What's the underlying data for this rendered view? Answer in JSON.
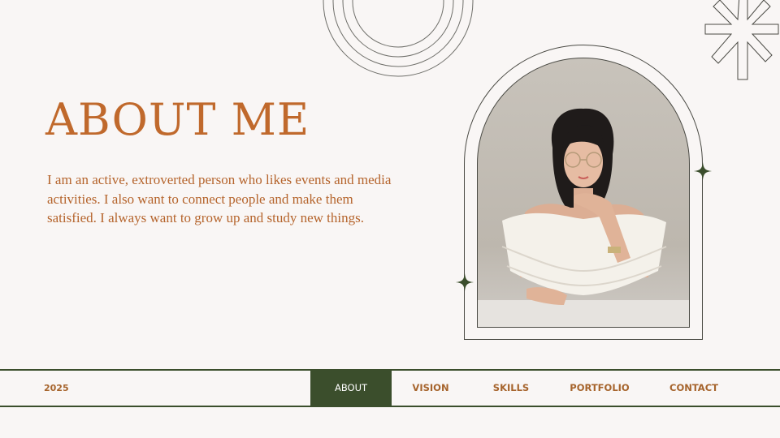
{
  "colors": {
    "background": "#f9f6f5",
    "accent": "#c0692c",
    "dark_green": "#3b4e2c",
    "line": "#4a4a44"
  },
  "title": "ABOUT ME",
  "bio": "I am an active, extroverted person who likes events and media activities. I also want to connect people and make them satisfied. I always want to grow up and study new things.",
  "photo": {
    "alt": "portrait-photo"
  },
  "decorations": {
    "top_arcs": "concentric-arcs-icon",
    "top_right": "starburst-icon",
    "sparkles": "four-point-star-icon"
  },
  "nav": {
    "year": "2025",
    "items": [
      {
        "label": "ABOUT",
        "active": true
      },
      {
        "label": "VISION",
        "active": false
      },
      {
        "label": "SKILLS",
        "active": false
      },
      {
        "label": "PORTFOLIO",
        "active": false
      },
      {
        "label": "CONTACT",
        "active": false
      }
    ]
  }
}
